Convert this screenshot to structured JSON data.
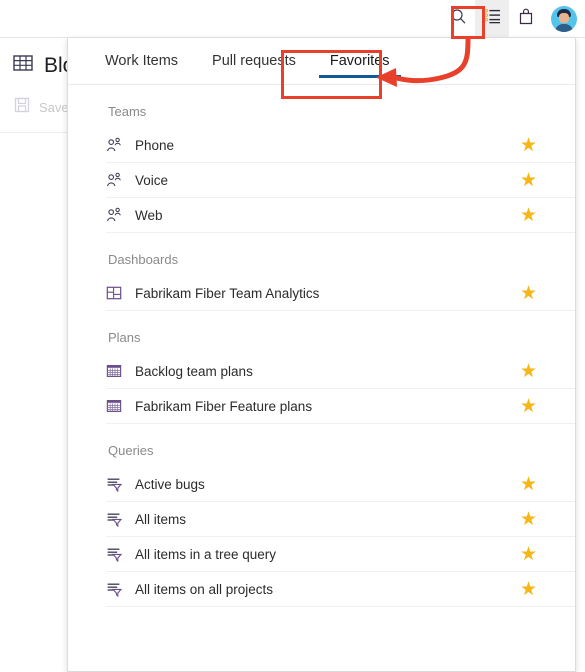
{
  "topbar": {
    "icons": [
      {
        "name": "search-icon",
        "glyph": "search"
      },
      {
        "name": "favorites-icon",
        "glyph": "list"
      },
      {
        "name": "marketplace-icon",
        "glyph": "bag"
      }
    ],
    "avatar_label": "user-avatar"
  },
  "background": {
    "title": "Blo",
    "title_icon": "board-table-icon",
    "save_label": "Save",
    "save_icon": "save-disk-icon"
  },
  "panel": {
    "tabs": [
      {
        "label": "Work Items",
        "selected": false
      },
      {
        "label": "Pull requests",
        "selected": false
      },
      {
        "label": "Favorites",
        "selected": true
      }
    ],
    "sections": [
      {
        "header": "Teams",
        "icon": "team-people-icon",
        "items": [
          {
            "label": "Phone",
            "favorited": true
          },
          {
            "label": "Voice",
            "favorited": true
          },
          {
            "label": "Web",
            "favorited": true
          }
        ]
      },
      {
        "header": "Dashboards",
        "icon": "dashboard-grid-icon",
        "items": [
          {
            "label": "Fabrikam Fiber Team Analytics",
            "favorited": true
          }
        ]
      },
      {
        "header": "Plans",
        "icon": "plan-calendar-icon",
        "items": [
          {
            "label": "Backlog team plans",
            "favorited": true
          },
          {
            "label": "Fabrikam Fiber Feature plans",
            "favorited": true
          }
        ]
      },
      {
        "header": "Queries",
        "icon": "query-filter-icon",
        "items": [
          {
            "label": "Active bugs",
            "favorited": true
          },
          {
            "label": "All items",
            "favorited": true
          },
          {
            "label": "All items in a tree query",
            "favorited": true
          },
          {
            "label": "All items on all projects",
            "favorited": true
          }
        ]
      }
    ],
    "star_glyph": "★"
  },
  "annotations": {
    "callout_color": "#e8402a",
    "highlight_icon_name": "favorites-icon-highlight",
    "highlight_tab_name": "favorites-tab-highlight",
    "arrow_name": "callout-arrow"
  },
  "colors": {
    "tab_underline": "#0e5a96",
    "star": "#f6b716",
    "annotation_red": "#e8402a"
  }
}
